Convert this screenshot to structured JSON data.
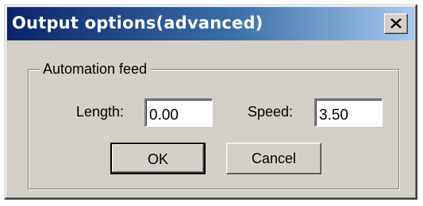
{
  "window": {
    "title": "Output options(advanced)",
    "close_icon": "close-icon"
  },
  "group": {
    "label": "Automation feed"
  },
  "fields": {
    "length_label": "Length:",
    "length_value": "0.00",
    "speed_label": "Speed:",
    "speed_value": "3.50"
  },
  "buttons": {
    "ok_label": "OK",
    "cancel_label": "Cancel"
  },
  "colors": {
    "titlebar_start": "#0a246a",
    "titlebar_end": "#a6caf0",
    "face": "#d4d0c8"
  }
}
